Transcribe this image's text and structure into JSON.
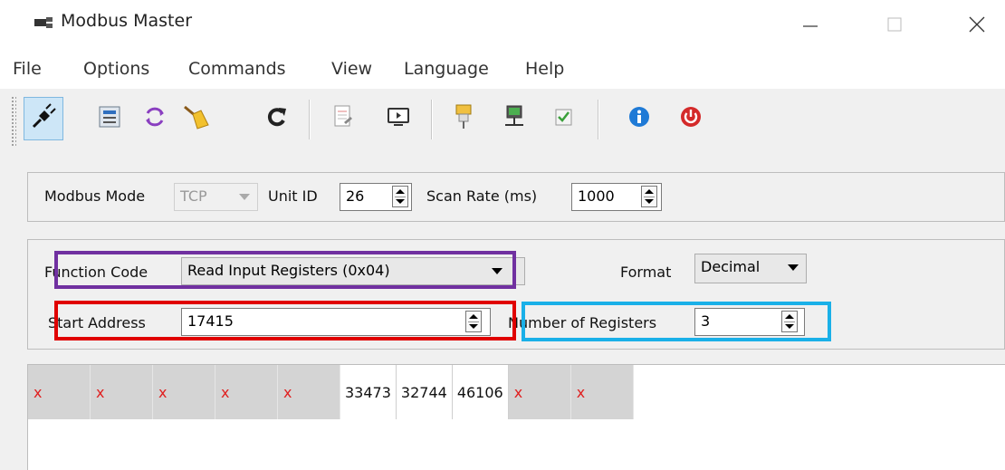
{
  "window": {
    "title": "Modbus Master"
  },
  "menu": [
    "File",
    "Options",
    "Commands",
    "View",
    "Language",
    "Help"
  ],
  "toolbar": {
    "icons": [
      "connect-icon",
      "settings-icon",
      "loop-icon",
      "clear-icon",
      "refresh-icon",
      "document-icon",
      "monitor-icon",
      "probe-icon",
      "network-icon",
      "checkbox-icon",
      "info-icon",
      "power-icon"
    ]
  },
  "connection": {
    "mode_label": "Modbus Mode",
    "mode_value": "TCP",
    "unit_label": "Unit ID",
    "unit_value": "26",
    "scan_label": "Scan Rate (ms)",
    "scan_value": "1000"
  },
  "request": {
    "function_label": "Function Code",
    "function_value": "Read Input Registers (0x04)",
    "format_label": "Format",
    "format_value": "Decimal",
    "start_label": "Start Address",
    "start_value": "17415",
    "count_label": "Number of Registers",
    "count_value": "3"
  },
  "registers": {
    "cells": [
      "x",
      "x",
      "x",
      "x",
      "x",
      "33473",
      "32744",
      "46106",
      "x",
      "x"
    ]
  },
  "highlights": {
    "function": "#7030a0",
    "start": "#e00000",
    "count": "#1ab0e8"
  }
}
